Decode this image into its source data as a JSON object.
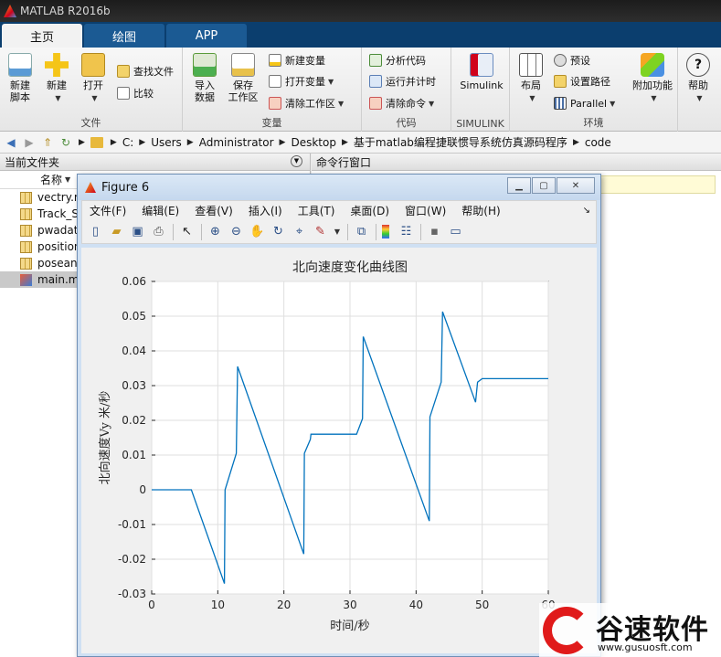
{
  "app": {
    "title": "MATLAB R2016b"
  },
  "ribbon_tabs": [
    "主页",
    "绘图",
    "APP"
  ],
  "ribbon": {
    "file_group": {
      "label": "文件",
      "new_script": "新建\n脚本",
      "new": "新建",
      "open": "打开",
      "find_files": "查找文件",
      "compare": "比较"
    },
    "variable_group": {
      "label": "变量",
      "import_data": "导入\n数据",
      "save_workspace": "保存\n工作区",
      "new_variable": "新建变量",
      "open_variable": "打开变量",
      "clear_workspace": "清除工作区"
    },
    "code_group": {
      "label": "代码",
      "analyze_code": "分析代码",
      "run_time": "运行并计时",
      "clear_commands": "清除命令"
    },
    "simulink_group": {
      "label": "SIMULINK",
      "simulink": "Simulink"
    },
    "env_group": {
      "label": "环境",
      "layout": "布局",
      "preferences": "预设",
      "set_path": "设置路径",
      "parallel": "Parallel",
      "addons": "附加功能"
    },
    "help_group": {
      "help": "帮助"
    }
  },
  "address_bar": {
    "path": [
      "C:",
      "Users",
      "Administrator",
      "Desktop",
      "基于matlab编程捷联惯导系统仿真源码程序",
      "code"
    ]
  },
  "current_folder": {
    "title": "当前文件夹",
    "column_name": "名称",
    "files": [
      "vectry.m",
      "Track_S",
      "pwadat",
      "position",
      "posean",
      "main.m"
    ]
  },
  "command_window": {
    "title": "命令行窗口"
  },
  "figure": {
    "title": "Figure 6",
    "menus": [
      "文件(F)",
      "编辑(E)",
      "查看(V)",
      "插入(I)",
      "工具(T)",
      "桌面(D)",
      "窗口(W)",
      "帮助(H)"
    ]
  },
  "chart_data": {
    "type": "line",
    "title": "北向速度变化曲线图",
    "xlabel": "时间/秒",
    "ylabel": "北向速度Vy 米/秒",
    "xlim": [
      0,
      60
    ],
    "ylim": [
      -0.03,
      0.06
    ],
    "xticks": [
      "0",
      "10",
      "20",
      "30",
      "40",
      "50",
      "60"
    ],
    "yticks": [
      "-0.03",
      "-0.02",
      "-0.01",
      "0",
      "0.01",
      "0.02",
      "0.03",
      "0.04",
      "0.05",
      "0.06"
    ],
    "grid": true,
    "color": "#0072bd",
    "x": [
      0,
      6,
      11,
      11.1,
      12.8,
      13,
      23,
      23.1,
      24,
      24.1,
      31,
      31.9,
      32,
      42,
      42.1,
      43.8,
      44,
      49,
      49.3,
      50,
      60
    ],
    "y": [
      0,
      0,
      -0.027,
      0,
      0.0105,
      0.0355,
      -0.0185,
      0.0105,
      0.0145,
      0.016,
      0.016,
      0.0205,
      0.0441,
      -0.009,
      0.021,
      0.031,
      0.0513,
      0.0252,
      0.031,
      0.032,
      0.032
    ]
  },
  "watermark": {
    "name": "谷速软件",
    "url": "www.gusuosft.com"
  }
}
